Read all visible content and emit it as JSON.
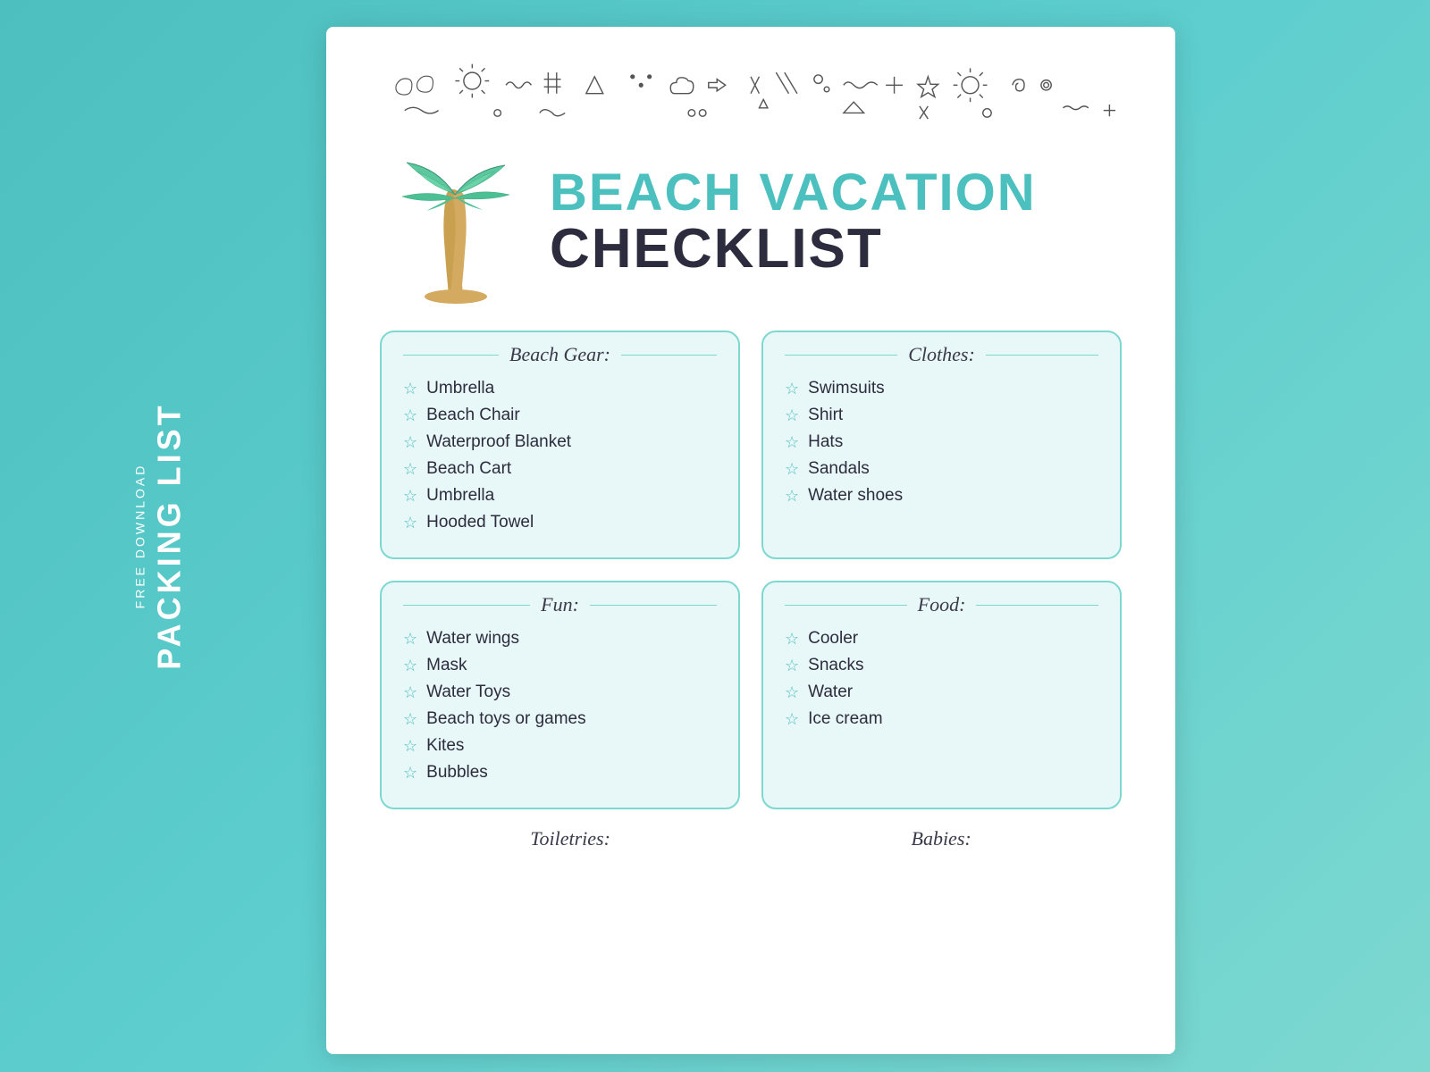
{
  "sidebar": {
    "free_download": "FREE DOWNLOAD",
    "packing_list": "PACKING LIST"
  },
  "title": {
    "line1": "BEACH VACATION",
    "line2": "CHECKLIST"
  },
  "sections": [
    {
      "id": "beach-gear",
      "title": "Beach Gear:",
      "items": [
        "Umbrella",
        "Beach Chair",
        "Waterproof Blanket",
        "Beach Cart",
        "Umbrella",
        "Hooded Towel"
      ]
    },
    {
      "id": "clothes",
      "title": "Clothes:",
      "items": [
        "Swimsuits",
        "Shirt",
        "Hats",
        "Sandals",
        "Water shoes"
      ]
    },
    {
      "id": "fun",
      "title": "Fun:",
      "items": [
        "Water wings",
        "Mask",
        "Water Toys",
        "Beach toys or games",
        "Kites",
        "Bubbles"
      ]
    },
    {
      "id": "food",
      "title": "Food:",
      "items": [
        "Cooler",
        "Snacks",
        "Water",
        "Ice cream"
      ]
    }
  ],
  "bottom_sections": [
    {
      "title": "Toiletries:"
    },
    {
      "title": "Babies:"
    }
  ]
}
